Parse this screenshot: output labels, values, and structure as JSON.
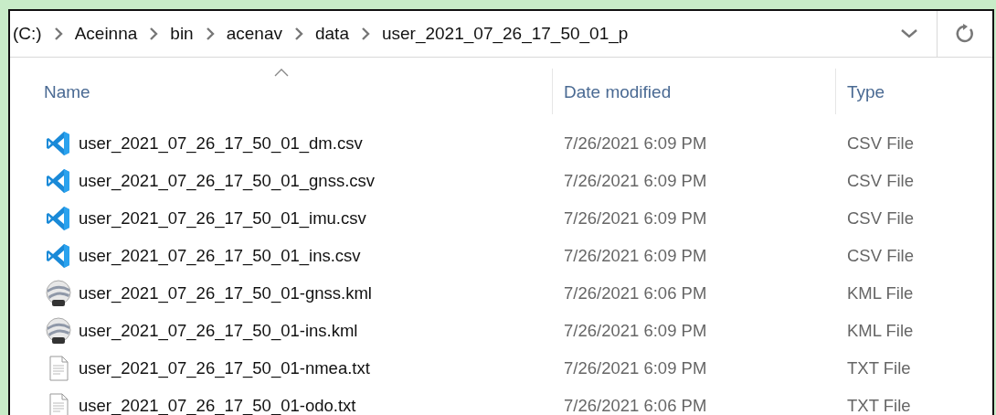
{
  "address_bar": {
    "path": [
      "(C:)",
      "Aceinna",
      "bin",
      "acenav",
      "data",
      "user_2021_07_26_17_50_01_p"
    ]
  },
  "table": {
    "columns": [
      {
        "label": "Name",
        "sorted": true
      },
      {
        "label": "Date modified",
        "sorted": false
      },
      {
        "label": "Type",
        "sorted": false
      }
    ],
    "rows": [
      {
        "kind": "code",
        "name": "user_2021_07_26_17_50_01_dm.csv",
        "date": "7/26/2021 6:09 PM",
        "type": "CSV File"
      },
      {
        "kind": "code",
        "name": "user_2021_07_26_17_50_01_gnss.csv",
        "date": "7/26/2021 6:09 PM",
        "type": "CSV File"
      },
      {
        "kind": "code",
        "name": "user_2021_07_26_17_50_01_imu.csv",
        "date": "7/26/2021 6:09 PM",
        "type": "CSV File"
      },
      {
        "kind": "code",
        "name": "user_2021_07_26_17_50_01_ins.csv",
        "date": "7/26/2021 6:09 PM",
        "type": "CSV File"
      },
      {
        "kind": "globe",
        "name": "user_2021_07_26_17_50_01-gnss.kml",
        "date": "7/26/2021 6:06 PM",
        "type": "KML File"
      },
      {
        "kind": "globe",
        "name": "user_2021_07_26_17_50_01-ins.kml",
        "date": "7/26/2021 6:09 PM",
        "type": "KML File"
      },
      {
        "kind": "text",
        "name": "user_2021_07_26_17_50_01-nmea.txt",
        "date": "7/26/2021 6:09 PM",
        "type": "TXT File"
      },
      {
        "kind": "text",
        "name": "user_2021_07_26_17_50_01-odo.txt",
        "date": "7/26/2021 6:06 PM",
        "type": "TXT File"
      }
    ]
  }
}
